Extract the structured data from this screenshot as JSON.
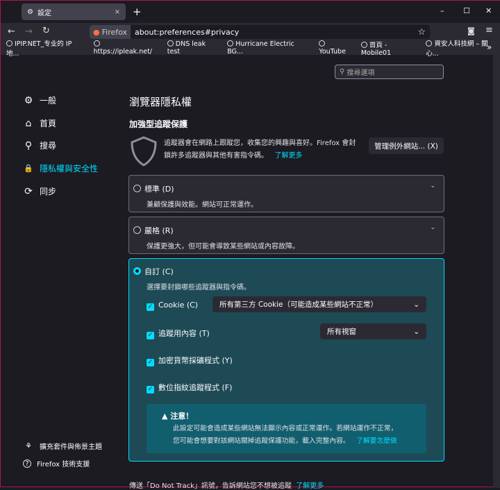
{
  "tab": {
    "title": "設定",
    "close": "×",
    "new": "+"
  },
  "window": {
    "min": "–",
    "max": "☐",
    "close": "✕"
  },
  "toolbar": {
    "back": "←",
    "forward": "→",
    "reload": "↻",
    "badge": "Firefox",
    "url": "about:preferences#privacy",
    "star": "☆",
    "pocket": "◙",
    "menu": "≡"
  },
  "bookmarks": [
    "IPIP.NET_专业的 IP 地...",
    "https://ipleak.net/",
    "DNS leak test",
    "Hurricane Electric BG...",
    "YouTube",
    "首頁 - Mobile01",
    "資安人科技網 – 關心..."
  ],
  "bookmarks_more": "»",
  "search": {
    "placeholder": "搜尋選項"
  },
  "sidebar": {
    "items": [
      {
        "label": "一般",
        "icon": "⚙"
      },
      {
        "label": "首頁",
        "icon": "⌂"
      },
      {
        "label": "搜尋",
        "icon": "⚲"
      },
      {
        "label": "隱私權與安全性",
        "icon": "🔒"
      },
      {
        "label": "同步",
        "icon": "⟳"
      }
    ],
    "bottom": [
      {
        "label": "擴充套件與佈景主題",
        "icon": "⚘"
      },
      {
        "label": "Firefox 技術支援",
        "icon": "?"
      }
    ]
  },
  "main": {
    "title": "瀏覽器隱私權",
    "etp_heading": "加強型追蹤保護",
    "etp_desc_1": "追蹤器會在網路上跟蹤您，收集您的興趣與喜好。Firefox 會封",
    "etp_desc_2": "鎖許多追蹤器與其他有害指令碼。",
    "learn_more": "了解更多",
    "exceptions_button": "管理例外網站... (X)",
    "standard": {
      "label": "標準 (D)",
      "desc": "兼顧保護與效能。網站可正常運作。"
    },
    "strict": {
      "label": "嚴格 (R)",
      "desc": "保護更強大，但可能會導致某些網站或內容故障。"
    },
    "custom": {
      "label": "自訂 (C)",
      "desc": "選擇要封鎖哪些追蹤器與指令碼。",
      "options": [
        {
          "label": "Cookie (C)",
          "checked": true
        },
        {
          "label": "追蹤用內容 (T)",
          "checked": true
        },
        {
          "label": "加密貨幣採礦程式 (Y)",
          "checked": true
        },
        {
          "label": "數位指紋追蹤程式 (F)",
          "checked": true
        }
      ],
      "cookie_select": "所有第三方 Cookie（可能造成某些網站不正常）",
      "tracking_select": "所有視窗",
      "warning": {
        "title": "注意！",
        "line1": "此設定可能會造成某些網站無法顯示內容或正常運作。若網站運作不正常，",
        "line2": "您可能會想要對該網站關掉追蹤保護功能，載入完整內容。",
        "link": "了解要怎麼做"
      }
    },
    "dnt": "傳送「Do Not Track」訊號，告訴網站您不想被追蹤",
    "dnt_link": "了解更多"
  },
  "colors": {
    "accent": "#00ddff",
    "custom_bg": "#1d4a55",
    "warning_bg": "#115e6e"
  }
}
